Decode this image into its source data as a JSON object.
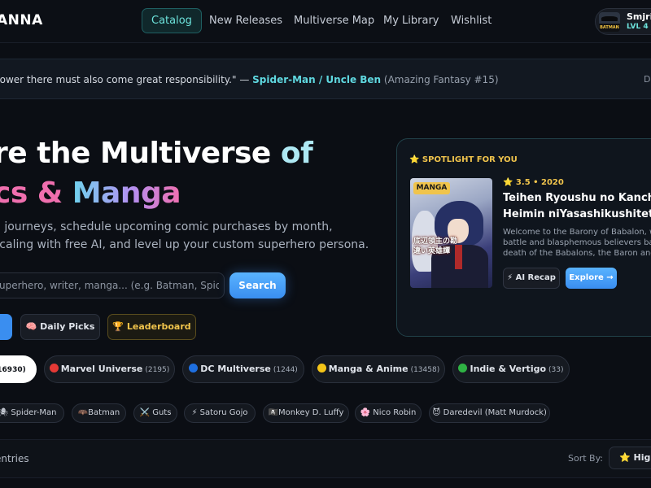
{
  "header": {
    "brand": "ANNA",
    "nav": [
      "Catalog",
      "New Releases",
      "Multiverse Map",
      "My Library",
      "Wishlist"
    ],
    "active_nav": "Catalog",
    "user": {
      "name": "Smjrifl",
      "level": "LVL 4 •",
      "avatar_tag": "BATMAN"
    }
  },
  "quote": {
    "text": "power there must also come great responsibility.\" — ",
    "author": "Spider-Man / Uncle Ben",
    "source": " (Amazing Fantasy #15)",
    "right": "D"
  },
  "hero": {
    "line1_main": "re the Multiverse ",
    "line1_accent": "of",
    "line2_a": "cs & ",
    "line2_b": "Manga",
    "sub1": "g journeys, schedule upcoming comic purchases by month,",
    "sub2": "scaling with free AI, and level up your custom superhero persona."
  },
  "search": {
    "placeholder": "uperhero, writer, manga... (e.g. Batman, Spider-Man",
    "button": "Search"
  },
  "actions": {
    "daily_picks": "🧠 Daily Picks",
    "leaderboard": "🏆 Leaderboard"
  },
  "spotlight": {
    "label": "⭐ SPOTLIGHT FOR YOU",
    "tag": "MANGA",
    "cover_text": "底辺領主の勘違い英雄譚",
    "rating": "⭐ 3.5 • 2020",
    "title_lines": [
      "Teihen Ryoushu no Kanchiga",
      "Heimin niYasashikushitetara"
    ],
    "desc_lines": [
      "Welcome to the Barony of Babalon, wh",
      "battle and blasphemous believers bab",
      "death of the Babalons, the Baron and B"
    ],
    "recap": "⚡ AI Recap",
    "explore": "Explore →"
  },
  "categories": [
    {
      "label": "",
      "count": "16930)"
    },
    {
      "label": "Marvel Universe",
      "count": "(2195)",
      "color": "#e53935"
    },
    {
      "label": "DC Multiverse",
      "count": "(1244)",
      "color": "#1e6fe0"
    },
    {
      "label": "Manga & Anime",
      "count": "(13458)",
      "color": "#f5c518"
    },
    {
      "label": "Indie & Vertigo",
      "count": "(33)",
      "color": "#2fb344"
    }
  ],
  "characters": [
    "🕷 Spider-Man",
    "🦇Batman",
    "⚔️ Guts",
    "⚡ Satoru Gojo",
    "🏴‍☠️Monkey D. Luffy",
    "🌸 Nico Robin",
    "😈 Daredevil (Matt Murdock)"
  ],
  "list": {
    "entries": "entries",
    "sort_label": "Sort By:",
    "sort_value": "⭐ Highe"
  }
}
